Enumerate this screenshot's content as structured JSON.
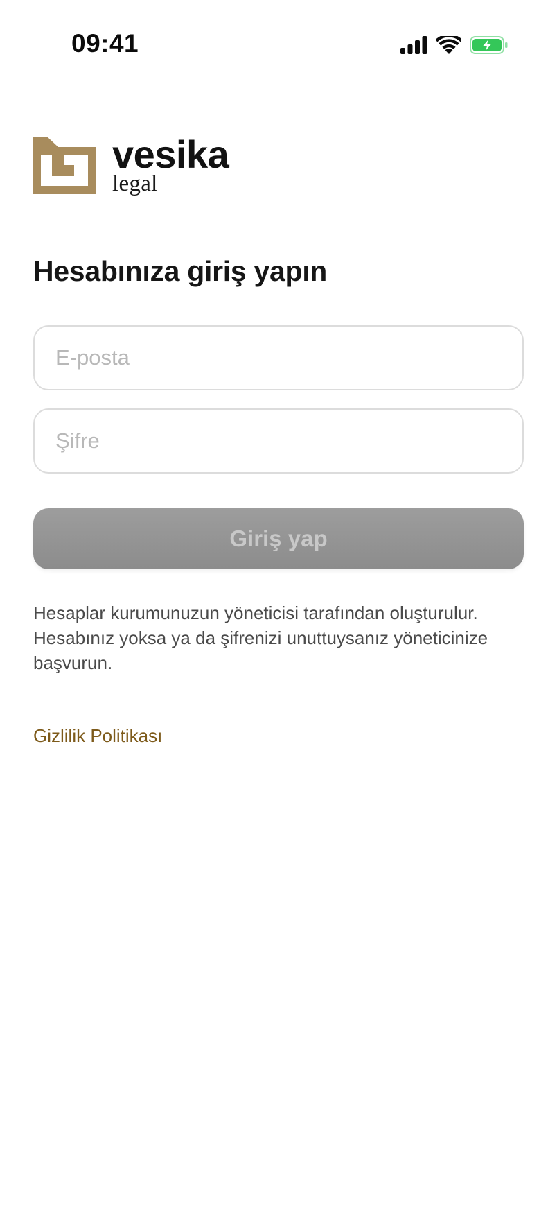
{
  "status_bar": {
    "time": "09:41",
    "icons": [
      "signal-icon",
      "wifi-icon",
      "battery-charging-icon"
    ],
    "battery_color": "#34c759"
  },
  "brand": {
    "name": "vesika",
    "subtitle": "legal",
    "logo_color": "#a88c5d"
  },
  "login": {
    "title": "Hesabınıza giriş yapın",
    "email_placeholder": "E-posta",
    "password_placeholder": "Şifre",
    "submit_label": "Giriş yap",
    "submit_enabled": false,
    "help_text": "Hesaplar kurumunuzun yöneticisi tarafından oluşturulur. Hesabınız yoksa ya da şifrenizi unuttuysanız yöneticinize başvurun.",
    "privacy_link": "Gizlilik Politikası"
  },
  "colors": {
    "link": "#7d5a1a",
    "button_disabled": "#959595",
    "field_border": "#dcdcdc"
  }
}
